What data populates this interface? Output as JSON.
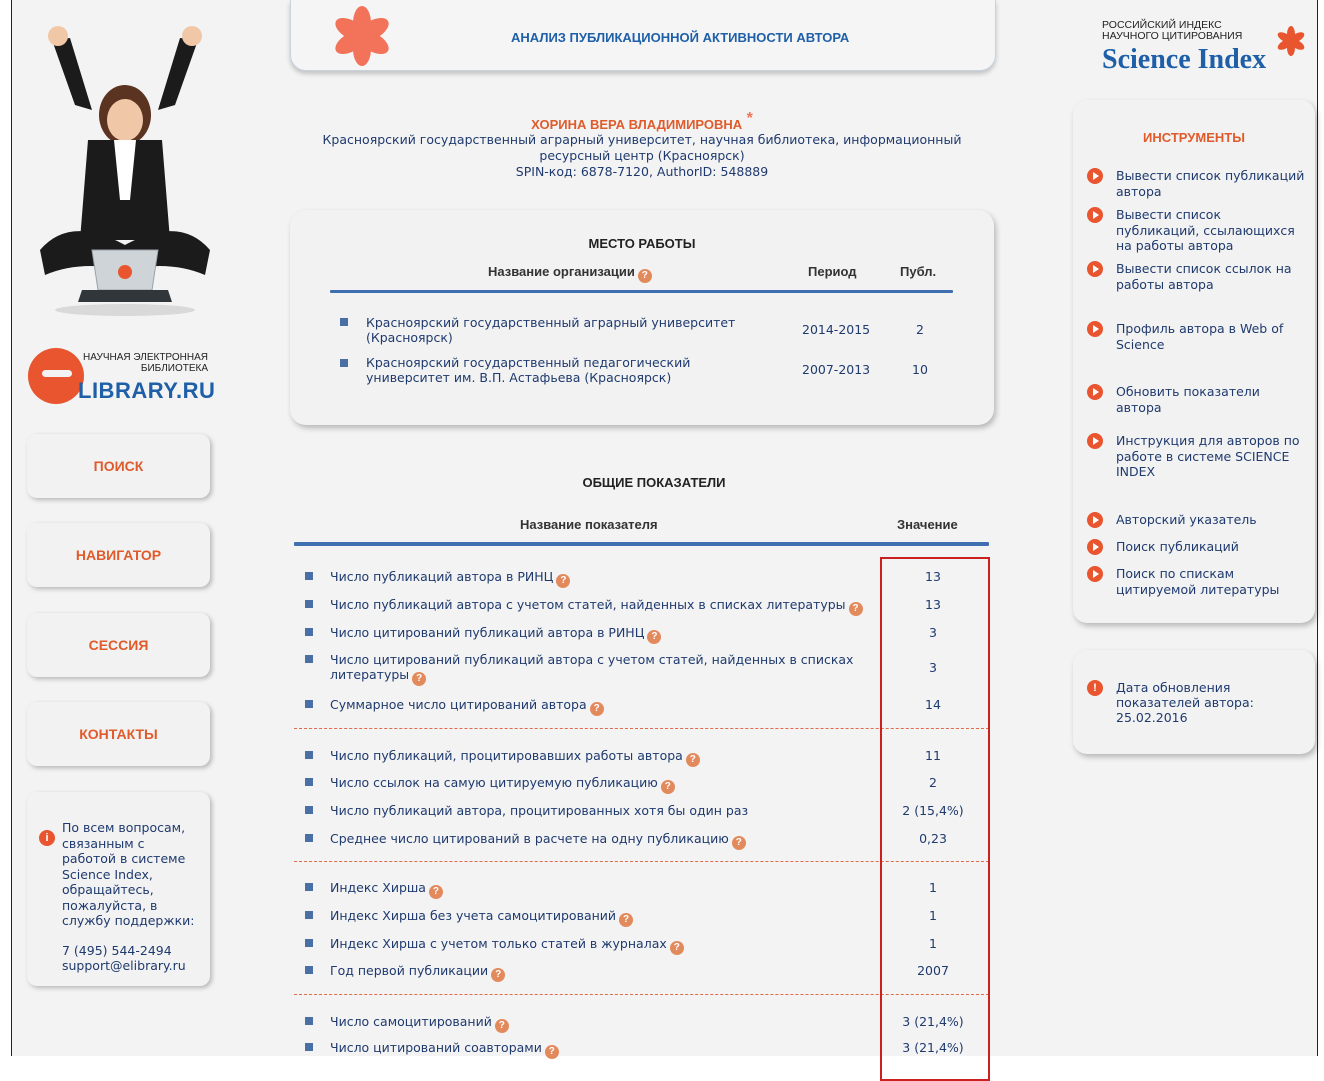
{
  "header": {
    "title": "АНАЛИЗ ПУБЛИКАЦИОННОЙ АКТИВНОСТИ АВТОРА"
  },
  "brand": {
    "small_line1": "НАУЧНАЯ ЭЛЕКТРОННАЯ",
    "small_line2": "БИБЛИОТЕКА",
    "name": "LIBRARY.RU",
    "ri_line1": "РОССИЙСКИЙ ИНДЕКС",
    "ri_line2": "НАУЧНОГО ЦИТИРОВАНИЯ",
    "ri_name": "Science Index"
  },
  "nav": {
    "search": "ПОИСК",
    "navigator": "НАВИГАТОР",
    "session": "СЕССИЯ",
    "contacts": "КОНТАКТЫ"
  },
  "support": {
    "text": "По всем вопросам, связанным с работой в системе Science Index, обращайтесь, пожалуйста, в службу поддержки:",
    "phone": "7 (495) 544-2494",
    "email": "support@elibrary.ru"
  },
  "author": {
    "name": "ХОРИНА ВЕРА ВЛАДИМИРОВНА",
    "affiliation": "Красноярский государственный аграрный университет, научная библиотека, информационный ресурсный центр (Красноярск)",
    "ids": "SPIN-код: 6878-7120, AuthorID: 548889"
  },
  "workplace": {
    "title": "МЕСТО РАБОТЫ",
    "col_org": "Название организации",
    "col_period": "Период",
    "col_pubs": "Публ.",
    "rows": [
      {
        "org": "Красноярский государственный аграрный университет (Красноярск)",
        "period": "2014-2015",
        "pubs": "2"
      },
      {
        "org": "Красноярский государственный педагогический университет им. В.П. Астафьева (Красноярск)",
        "period": "2007-2013",
        "pubs": "10"
      }
    ]
  },
  "indicators": {
    "title": "ОБЩИЕ ПОКАЗАТЕЛИ",
    "col_name": "Название показателя",
    "col_value": "Значение",
    "rows": [
      {
        "name": "Число публикаций автора в РИНЦ",
        "value": "13"
      },
      {
        "name": "Число публикаций автора с учетом статей, найденных в списках литературы",
        "value": "13"
      },
      {
        "name": "Число цитирований публикаций автора в РИНЦ",
        "value": "3"
      },
      {
        "name": "Число цитирований публикаций автора с учетом статей, найденных в списках литературы",
        "value": "3"
      },
      {
        "name": "Суммарное число цитирований автора",
        "value": "14"
      },
      {
        "name": "Число публикаций, процитировавших работы автора",
        "value": "11"
      },
      {
        "name": "Число ссылок на самую цитируемую публикацию",
        "value": "2"
      },
      {
        "name": "Число публикаций автора, процитированных хотя бы один раз",
        "value": "2 (15,4%)"
      },
      {
        "name": "Среднее число цитирований в расчете на одну публикацию",
        "value": "0,23"
      },
      {
        "name": "Индекс Хирша",
        "value": "1"
      },
      {
        "name": "Индекс Хирша без учета самоцитирований",
        "value": "1"
      },
      {
        "name": "Индекс Хирша с учетом только статей в журналах",
        "value": "1"
      },
      {
        "name": "Год первой публикации",
        "value": "2007"
      },
      {
        "name": "Число самоцитирований",
        "value": "3 (21,4%)"
      },
      {
        "name": "Число цитирований соавторами",
        "value": "3 (21,4%)"
      }
    ]
  },
  "tools": {
    "title": "ИНСТРУМЕНТЫ",
    "items": [
      "Вывести список публикаций автора",
      "Вывести список публикаций, ссылающихся на работы автора",
      "Вывести список ссылок на работы автора",
      "Профиль автора в Web of Science",
      "Обновить показатели автора",
      "Инструкция для авторов по работе в системе SCIENCE INDEX",
      "Авторский указатель",
      "Поиск публикаций",
      "Поиск по спискам цитируемой литературы"
    ]
  },
  "update": {
    "text": "Дата обновления показателей автора: 25.02.2016"
  },
  "colors": {
    "accent_orange": "#e05b2b",
    "link_blue": "#1f3a6e",
    "brand_blue": "#1e5fa8",
    "highlight_red": "#cc2020"
  }
}
